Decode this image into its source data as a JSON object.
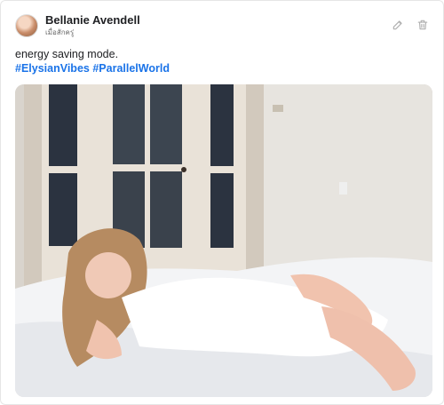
{
  "post": {
    "author": "Bellanie Avendell",
    "subtitle": "เมื่อสักครู่",
    "text": "energy saving mode.",
    "hashtags": [
      "#ElysianVibes",
      "#ParallelWorld"
    ]
  },
  "icons": {
    "edit": "pencil-icon",
    "delete": "trash-icon"
  },
  "colors": {
    "hashtag": "#1a73e8",
    "text": "#202124"
  }
}
